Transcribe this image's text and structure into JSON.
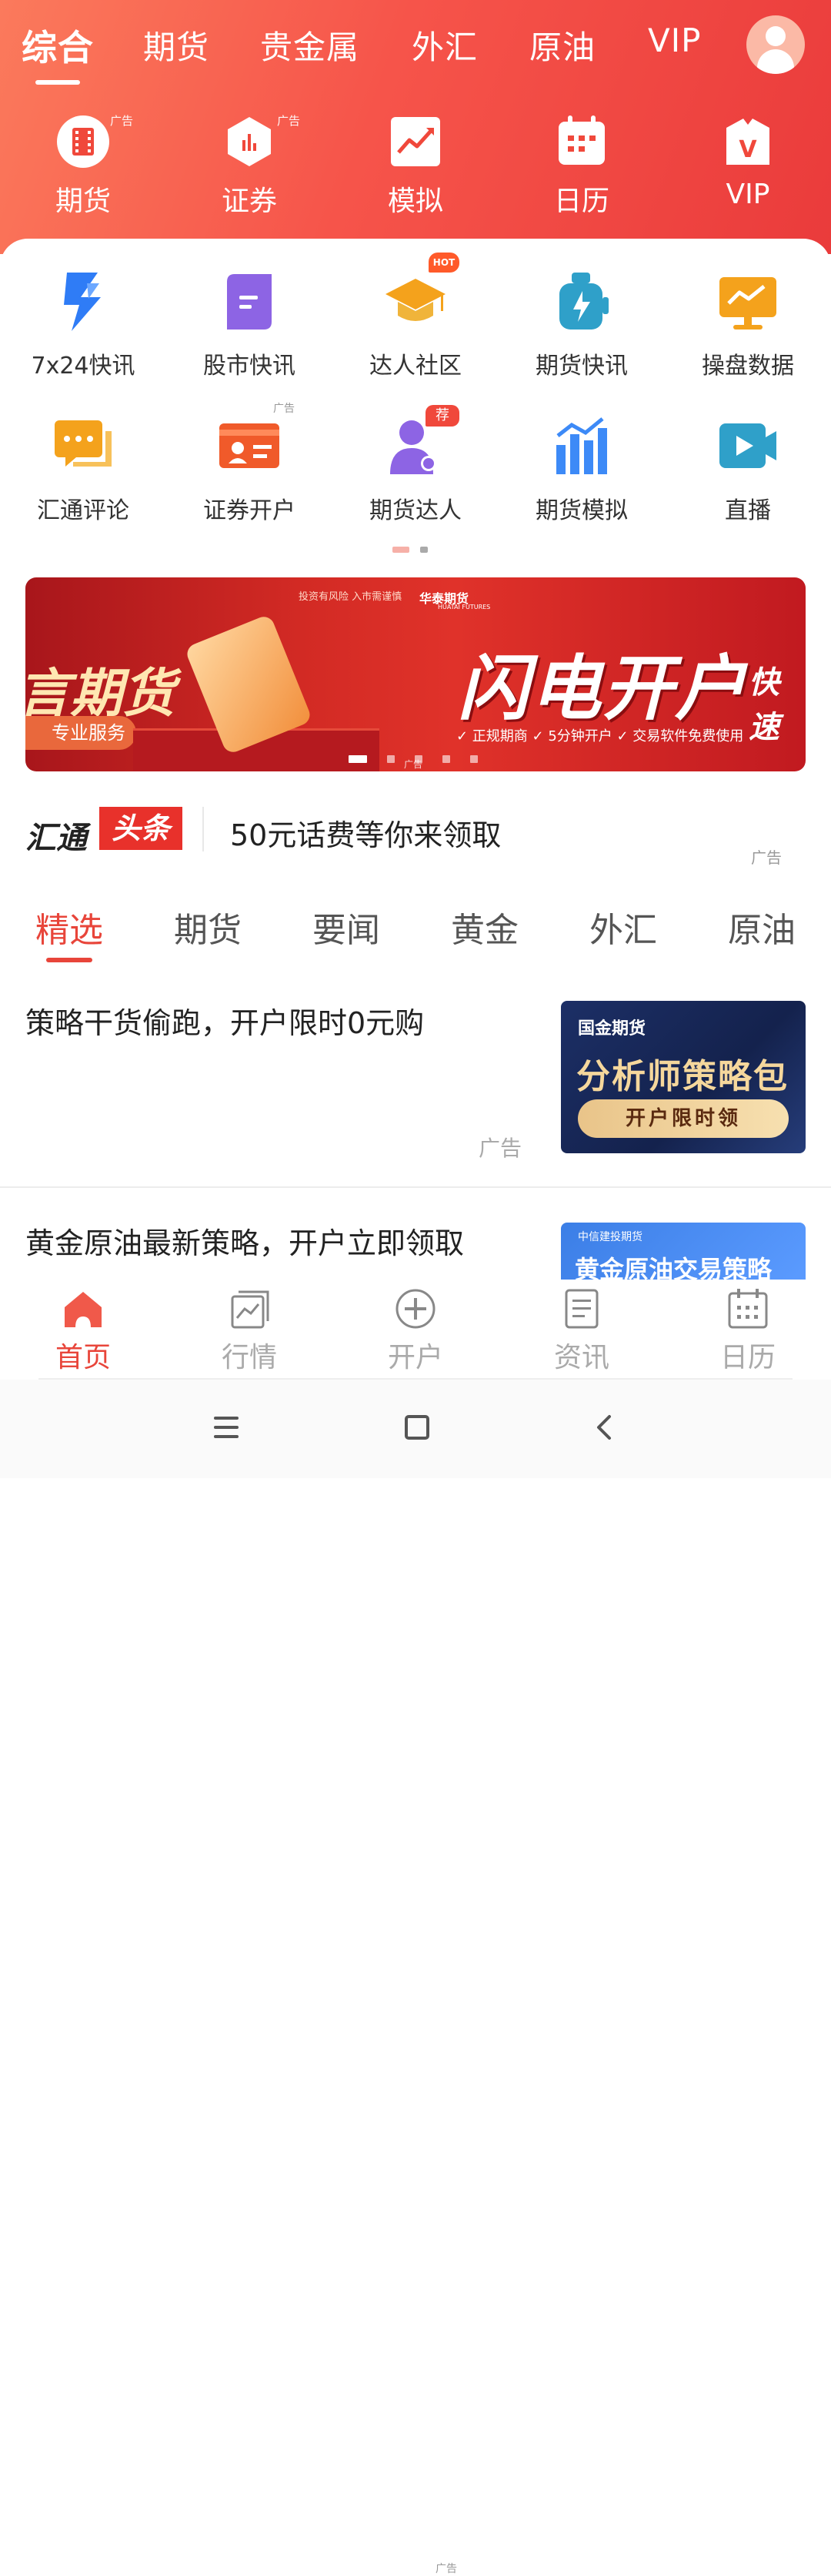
{
  "top_nav": {
    "tabs": [
      "综合",
      "期货",
      "贵金属",
      "外汇",
      "原油",
      "VIP"
    ],
    "active_index": 0
  },
  "shortcuts": [
    {
      "label": "期货",
      "icon": "film-icon",
      "ad": "广告"
    },
    {
      "label": "证券",
      "icon": "hexagon-chart-icon",
      "ad": "广告"
    },
    {
      "label": "模拟",
      "icon": "trend-chart-icon"
    },
    {
      "label": "日历",
      "icon": "calendar-icon"
    },
    {
      "label": "VIP",
      "icon": "vip-bag-icon",
      "mark": "V"
    }
  ],
  "grid": [
    {
      "label": "7x24快讯",
      "icon": "lightning-icon"
    },
    {
      "label": "股市快讯",
      "icon": "message-card-icon"
    },
    {
      "label": "达人社区",
      "icon": "graduation-cap-icon",
      "badge": "HOT"
    },
    {
      "label": "期货快讯",
      "icon": "battery-bolt-icon"
    },
    {
      "label": "操盘数据",
      "icon": "monitor-chart-icon"
    },
    {
      "label": "汇通评论",
      "icon": "chat-bubble-icon"
    },
    {
      "label": "证券开户",
      "icon": "id-card-icon",
      "ad": "广告"
    },
    {
      "label": "期货达人",
      "icon": "person-icon",
      "badge": "荐"
    },
    {
      "label": "期货模拟",
      "icon": "bar-chart-icon"
    },
    {
      "label": "直播",
      "icon": "video-camera-icon"
    }
  ],
  "banner": {
    "left_text": "言期货",
    "left_pill": "专业服务",
    "risk_note": "投资有风险 入市需谨慎",
    "brand": "华泰期货",
    "brand_en": "HUATAI FUTURES",
    "headline": "闪电开户",
    "headline_suffix": "快速",
    "features": "✓ 正规期商 ✓ 5分钟开户 ✓ 交易软件免费使用",
    "ad": "广告"
  },
  "headline": {
    "logo_part1": "汇通",
    "logo_part2": "头条",
    "text": "50元话费等你来领取",
    "ad": "广告"
  },
  "categories": [
    "精选",
    "期货",
    "要闻",
    "黄金",
    "外汇",
    "原油"
  ],
  "news": [
    {
      "title": "策略干货偷跑，开户限时0元购",
      "ad": "广告",
      "thumb": {
        "brand": "国金期货",
        "big": "分析师策略包",
        "button": "开户限时领"
      }
    },
    {
      "title": "黄金原油最新策略，开户立即领取",
      "thumb": {
        "brand": "中信建投期货",
        "big": "黄金原油交易策略"
      }
    }
  ],
  "tabbar": [
    {
      "label": "首页",
      "icon": "home-icon",
      "active": true
    },
    {
      "label": "行情",
      "icon": "market-chart-icon"
    },
    {
      "label": "开户",
      "icon": "plus-circle-icon",
      "ad": "广告"
    },
    {
      "label": "资讯",
      "icon": "document-icon"
    },
    {
      "label": "日历",
      "icon": "calendar-icon"
    }
  ],
  "colors": {
    "accent": "#e8453a",
    "header_start": "#fb7a5c",
    "header_end": "#ea3b3b"
  }
}
